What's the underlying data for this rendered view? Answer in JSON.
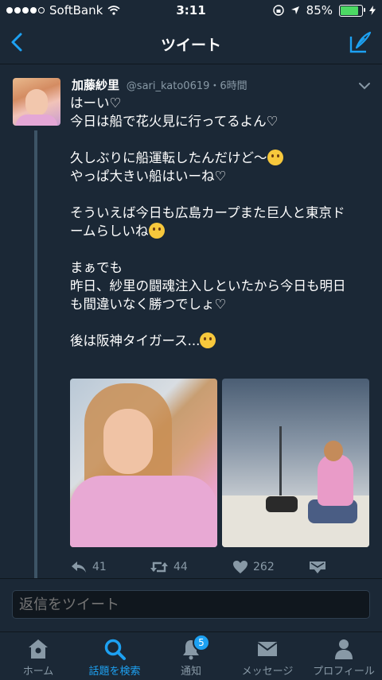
{
  "status_bar": {
    "carrier": "SoftBank",
    "time": "3:11",
    "battery": "85%",
    "battery_level": 0.85
  },
  "nav": {
    "title": "ツイート"
  },
  "tweet": {
    "author_name": "加藤紗里",
    "handle": "@sari_kato0619",
    "time_ago": "・6時間",
    "lines": {
      "l1": "はーい♡",
      "l2": "今日は船で花火見に行ってるよん♡",
      "l3": "久しぶりに船運転したんだけど〜",
      "l4": "やっぱ大きい船はいーね♡",
      "l5": "そういえば今日も広島カープまた巨人と東京ド",
      "l6": "ームらしいね",
      "l7": "まぁでも",
      "l8": "昨日、紗里の闘魂注入しといたから今日も明日",
      "l9": "も間違いなく勝つでしょ♡",
      "l10": "後は阪神タイガース..."
    },
    "actions": {
      "reply_count": "41",
      "retweet_count": "44",
      "like_count": "262"
    }
  },
  "reply": {
    "placeholder": "返信をツイート"
  },
  "tabs": {
    "home": "ホーム",
    "explore": "話題を検索",
    "notifications": "通知",
    "notifications_badge": "5",
    "messages": "メッセージ",
    "profile": "プロフィール"
  },
  "colors": {
    "accent": "#1da1f2",
    "background": "#1b2836",
    "muted": "#8899a6"
  }
}
